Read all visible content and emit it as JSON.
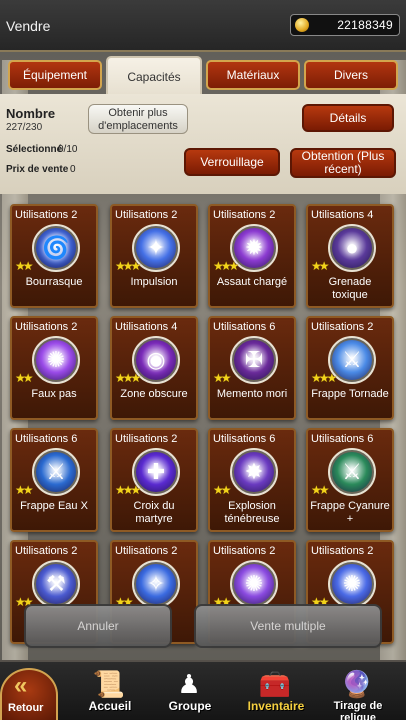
{
  "header": {
    "title": "Vendre",
    "gold": "22188349"
  },
  "tabs": [
    {
      "label": "Équipement"
    },
    {
      "label": "Capacités"
    },
    {
      "label": "Matériaux"
    },
    {
      "label": "Divers"
    }
  ],
  "info": {
    "count_title": "Nombre",
    "count_value": "227/230",
    "slots_button": "Obtenir plus d'emplacements",
    "details_button": "Détails",
    "selected_label": "Sélectionné",
    "selected_value": "0/10",
    "price_label": "Prix de vente",
    "price_value": "0",
    "lock_button": "Verrouillage",
    "obtain_button": "Obtention (Plus récent)"
  },
  "cards": [
    {
      "uses": "Utilisations 2",
      "name": "Bourrasque",
      "stars": "★★",
      "color": "#3a5fd0",
      "icon": "whirlwind-icon"
    },
    {
      "uses": "Utilisations 2",
      "name": "Impulsion",
      "stars": "★★★",
      "color": "#4470e6",
      "icon": "impulse-icon"
    },
    {
      "uses": "Utilisations 2",
      "name": "Assaut chargé",
      "stars": "★★★",
      "color": "#8b3ad0",
      "icon": "charged-assault-icon"
    },
    {
      "uses": "Utilisations 4",
      "name": "Grenade toxique",
      "stars": "★★",
      "color": "#5a3a9a",
      "icon": "grenade-icon"
    },
    {
      "uses": "Utilisations 2",
      "name": "Faux pas",
      "stars": "★★",
      "color": "#9a4ae8",
      "icon": "misstep-icon"
    },
    {
      "uses": "Utilisations 4",
      "name": "Zone obscure",
      "stars": "★★★",
      "color": "#7a2ab8",
      "icon": "dark-zone-icon"
    },
    {
      "uses": "Utilisations 6",
      "name": "Memento mori",
      "stars": "★★",
      "color": "#6a2a9a",
      "icon": "memento-mori-icon"
    },
    {
      "uses": "Utilisations 2",
      "name": "Frappe Tornade",
      "stars": "★★★",
      "color": "#4a8ae6",
      "icon": "tornado-strike-icon"
    },
    {
      "uses": "Utilisations 6",
      "name": "Frappe Eau X",
      "stars": "★★",
      "color": "#2a6ad0",
      "icon": "water-strike-icon"
    },
    {
      "uses": "Utilisations 2",
      "name": "Croix du martyre",
      "stars": "★★★",
      "color": "#5a2ad0",
      "icon": "martyr-cross-icon"
    },
    {
      "uses": "Utilisations 6",
      "name": "Explosion ténébreuse",
      "stars": "★★",
      "color": "#6a3ac0",
      "icon": "dark-explosion-icon"
    },
    {
      "uses": "Utilisations 6",
      "name": "Frappe Cyanure +",
      "stars": "★★",
      "color": "#2a8a5a",
      "icon": "cyanide-strike-icon"
    },
    {
      "uses": "Utilisations 2",
      "name": "",
      "stars": "★★",
      "color": "#4a5ad0",
      "icon": "hammer-icon"
    },
    {
      "uses": "Utilisations 2",
      "name": "",
      "stars": "★★",
      "color": "#3a6ae0",
      "icon": "spark-icon"
    },
    {
      "uses": "Utilisations 2",
      "name": "",
      "stars": "★★",
      "color": "#8a4ae0",
      "icon": "misstep-icon"
    },
    {
      "uses": "Utilisations 2",
      "name": "",
      "stars": "★★",
      "color": "#4a6ae6",
      "icon": "misstep-icon"
    }
  ],
  "actions": {
    "cancel": "Annuler",
    "multi_sell": "Vente multiple"
  },
  "nav": {
    "back": "Retour",
    "items": [
      {
        "label": "Accueil",
        "icon": "home-icon"
      },
      {
        "label": "Groupe",
        "icon": "party-icon"
      },
      {
        "label": "Inventaire",
        "icon": "inventory-icon"
      },
      {
        "label": "Tirage de relique",
        "icon": "relic-draw-icon"
      }
    ]
  }
}
